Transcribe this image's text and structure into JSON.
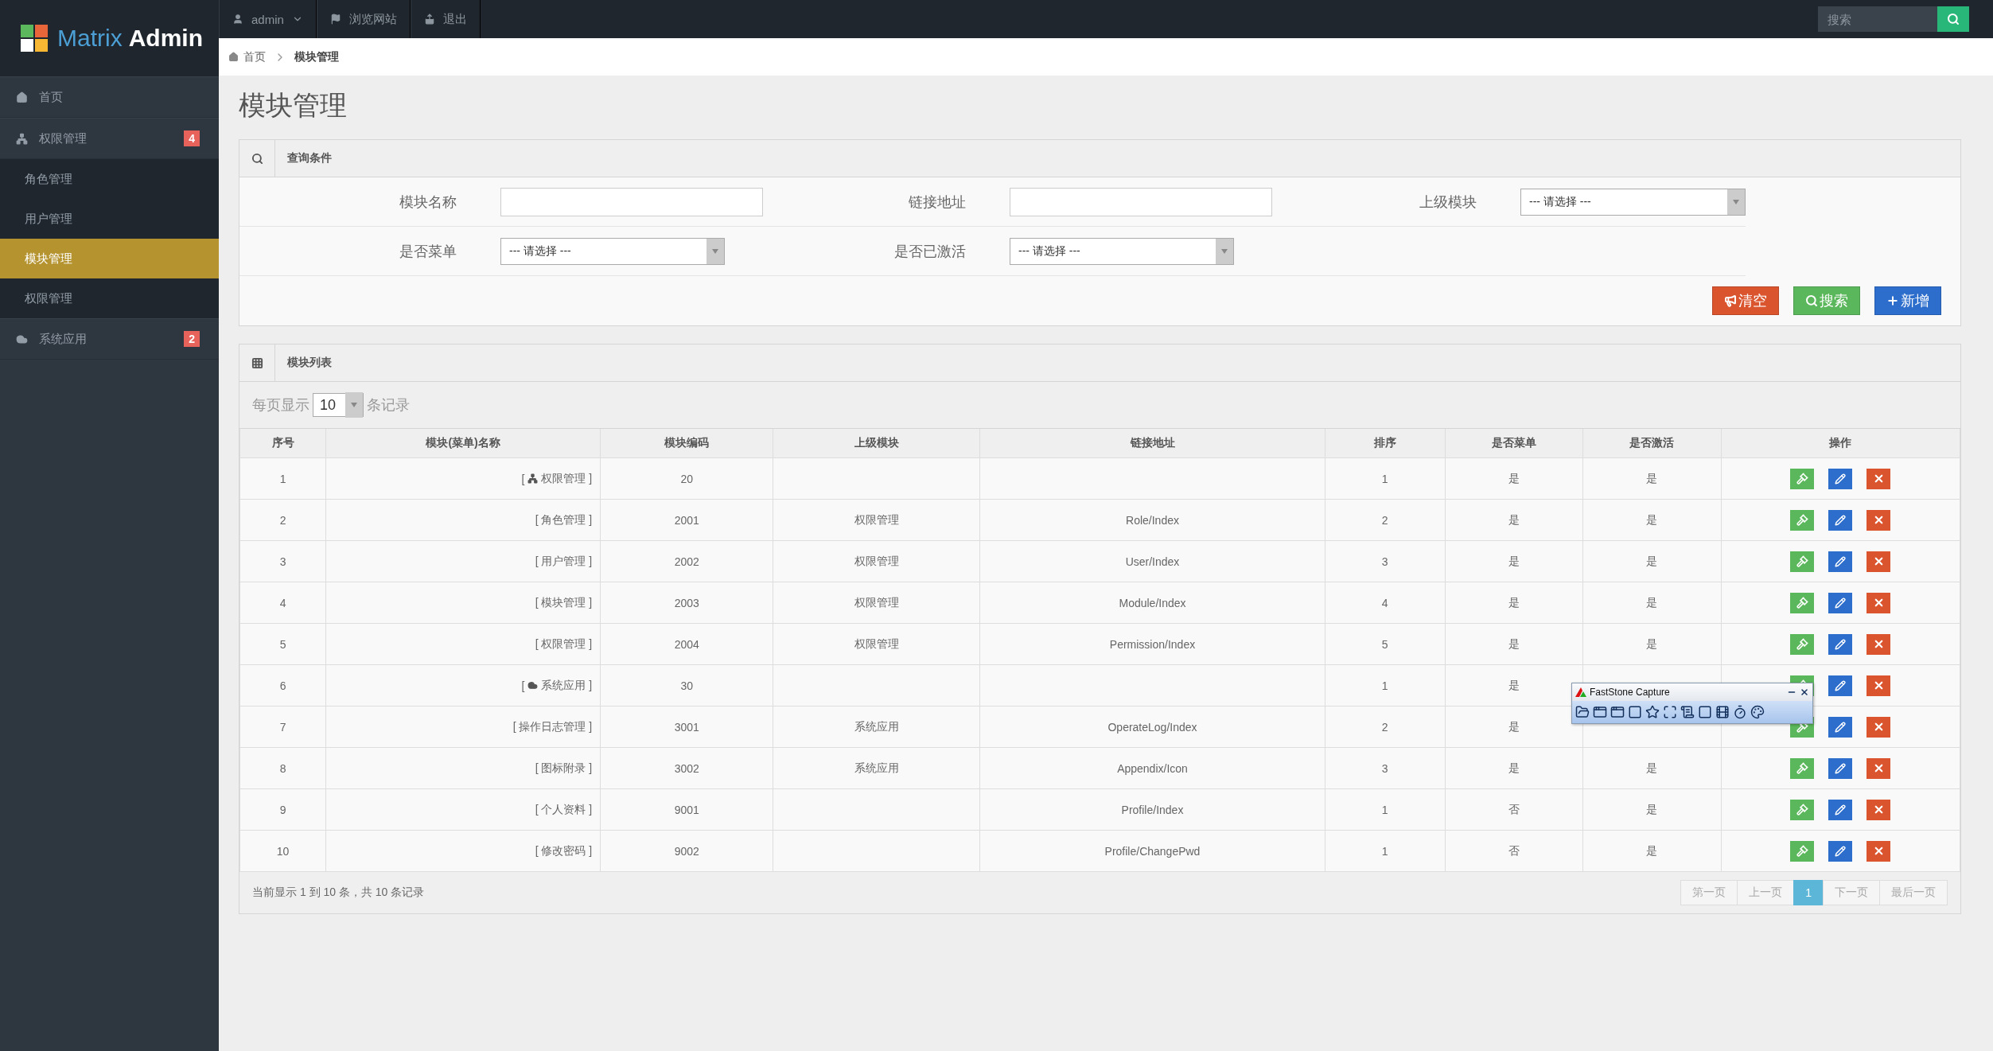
{
  "topbar": {
    "logo": {
      "word_1": "Matrix",
      "word_2": "Admin"
    },
    "menu": [
      {
        "label": "admin",
        "kind": "dropdown"
      },
      {
        "label": "浏览网站",
        "kind": "link"
      },
      {
        "label": "退出",
        "kind": "link"
      }
    ],
    "search": {
      "placeholder": "搜索"
    }
  },
  "sidebar": {
    "items": [
      {
        "label": "首页",
        "selected": false
      },
      {
        "label": "权限管理",
        "badge": "4",
        "selected": false,
        "children": [
          {
            "label": "角色管理",
            "selected": false
          },
          {
            "label": "用户管理",
            "selected": false
          },
          {
            "label": "模块管理",
            "selected": true
          },
          {
            "label": "权限管理",
            "selected": false
          }
        ]
      },
      {
        "label": "系统应用",
        "badge": "2",
        "selected": false
      }
    ]
  },
  "breadcrumb": [
    "首页",
    "模块管理"
  ],
  "page_title": "模块管理",
  "search_panel": {
    "title": "查询条件",
    "fields": [
      {
        "label": "模块名称",
        "kind": "text"
      },
      {
        "label": "链接地址",
        "kind": "text"
      },
      {
        "label": "上级模块",
        "kind": "select",
        "value": "--- 请选择 ---"
      },
      {
        "label": "是否菜单",
        "kind": "select",
        "value": "--- 请选择 ---"
      },
      {
        "label": "是否已激活",
        "kind": "select",
        "value": "--- 请选择 ---"
      }
    ],
    "buttons": [
      {
        "label": "清空",
        "kind": "danger"
      },
      {
        "label": "搜索",
        "kind": "success"
      },
      {
        "label": "新增",
        "kind": "primary"
      }
    ]
  },
  "list_panel": {
    "title": "模块列表",
    "page_size": {
      "prefix": "每页显示",
      "value": "10",
      "suffix": "条记录"
    },
    "table": {
      "columns": [
        "序号",
        "模块(菜单)名称",
        "模块编码",
        "上级模块",
        "链接地址",
        "排序",
        "是否菜单",
        "是否激活",
        "操作"
      ],
      "rows": [
        {
          "no": "1",
          "kind": "top",
          "bracket_open": "[",
          "name": "权限管理 ]",
          "code": "20",
          "sort": "1",
          "menu": "是",
          "active": "是"
        },
        {
          "no": "2",
          "kind": "child",
          "name": "[ 角色管理 ]",
          "code": "2001",
          "parent": "权限管理",
          "link": "Role/Index",
          "sort": "2",
          "menu": "是",
          "active": "是"
        },
        {
          "no": "3",
          "kind": "child",
          "name": "[ 用户管理 ]",
          "code": "2002",
          "parent": "权限管理",
          "link": "User/Index",
          "sort": "3",
          "menu": "是",
          "active": "是"
        },
        {
          "no": "4",
          "kind": "child",
          "name": "[ 模块管理 ]",
          "code": "2003",
          "parent": "权限管理",
          "link": "Module/Index",
          "sort": "4",
          "menu": "是",
          "active": "是"
        },
        {
          "no": "5",
          "kind": "child",
          "name": "[ 权限管理 ]",
          "code": "2004",
          "parent": "权限管理",
          "link": "Permission/Index",
          "sort": "5",
          "menu": "是",
          "active": "是"
        },
        {
          "no": "6",
          "kind": "top",
          "bracket_open": "[",
          "name": "系统应用 ]",
          "code": "30",
          "sort": "1",
          "menu": "是"
        },
        {
          "no": "7",
          "kind": "child",
          "name": "[ 操作日志管理 ]",
          "code": "3001",
          "parent": "系统应用",
          "link": "OperateLog/Index",
          "sort": "2",
          "menu": "是"
        },
        {
          "no": "8",
          "kind": "child",
          "name": "[ 图标附录 ]",
          "code": "3002",
          "parent": "系统应用",
          "link": "Appendix/Icon",
          "sort": "3",
          "menu": "是",
          "active": "是"
        },
        {
          "no": "9",
          "kind": "child",
          "name": "[ 个人资料 ]",
          "code": "9001",
          "link": "Profile/Index",
          "sort": "1",
          "menu": "否",
          "active": "是"
        },
        {
          "no": "10",
          "kind": "child",
          "name": "[ 修改密码 ]",
          "code": "9002",
          "link": "Profile/ChangePwd",
          "sort": "1",
          "menu": "否",
          "active": "是"
        }
      ]
    },
    "info": "当前显示 1 到 10 条，共 10 条记录",
    "pagination": [
      {
        "label": "第一页",
        "selected": false,
        "disabled": true
      },
      {
        "label": "上一页",
        "selected": false,
        "disabled": true
      },
      {
        "label": "1",
        "selected": true,
        "disabled": false
      },
      {
        "label": "下一页",
        "selected": false,
        "disabled": true
      },
      {
        "label": "最后一页",
        "selected": false,
        "disabled": true
      }
    ]
  },
  "capture_toolbar": {
    "title": "FastStone Capture"
  }
}
